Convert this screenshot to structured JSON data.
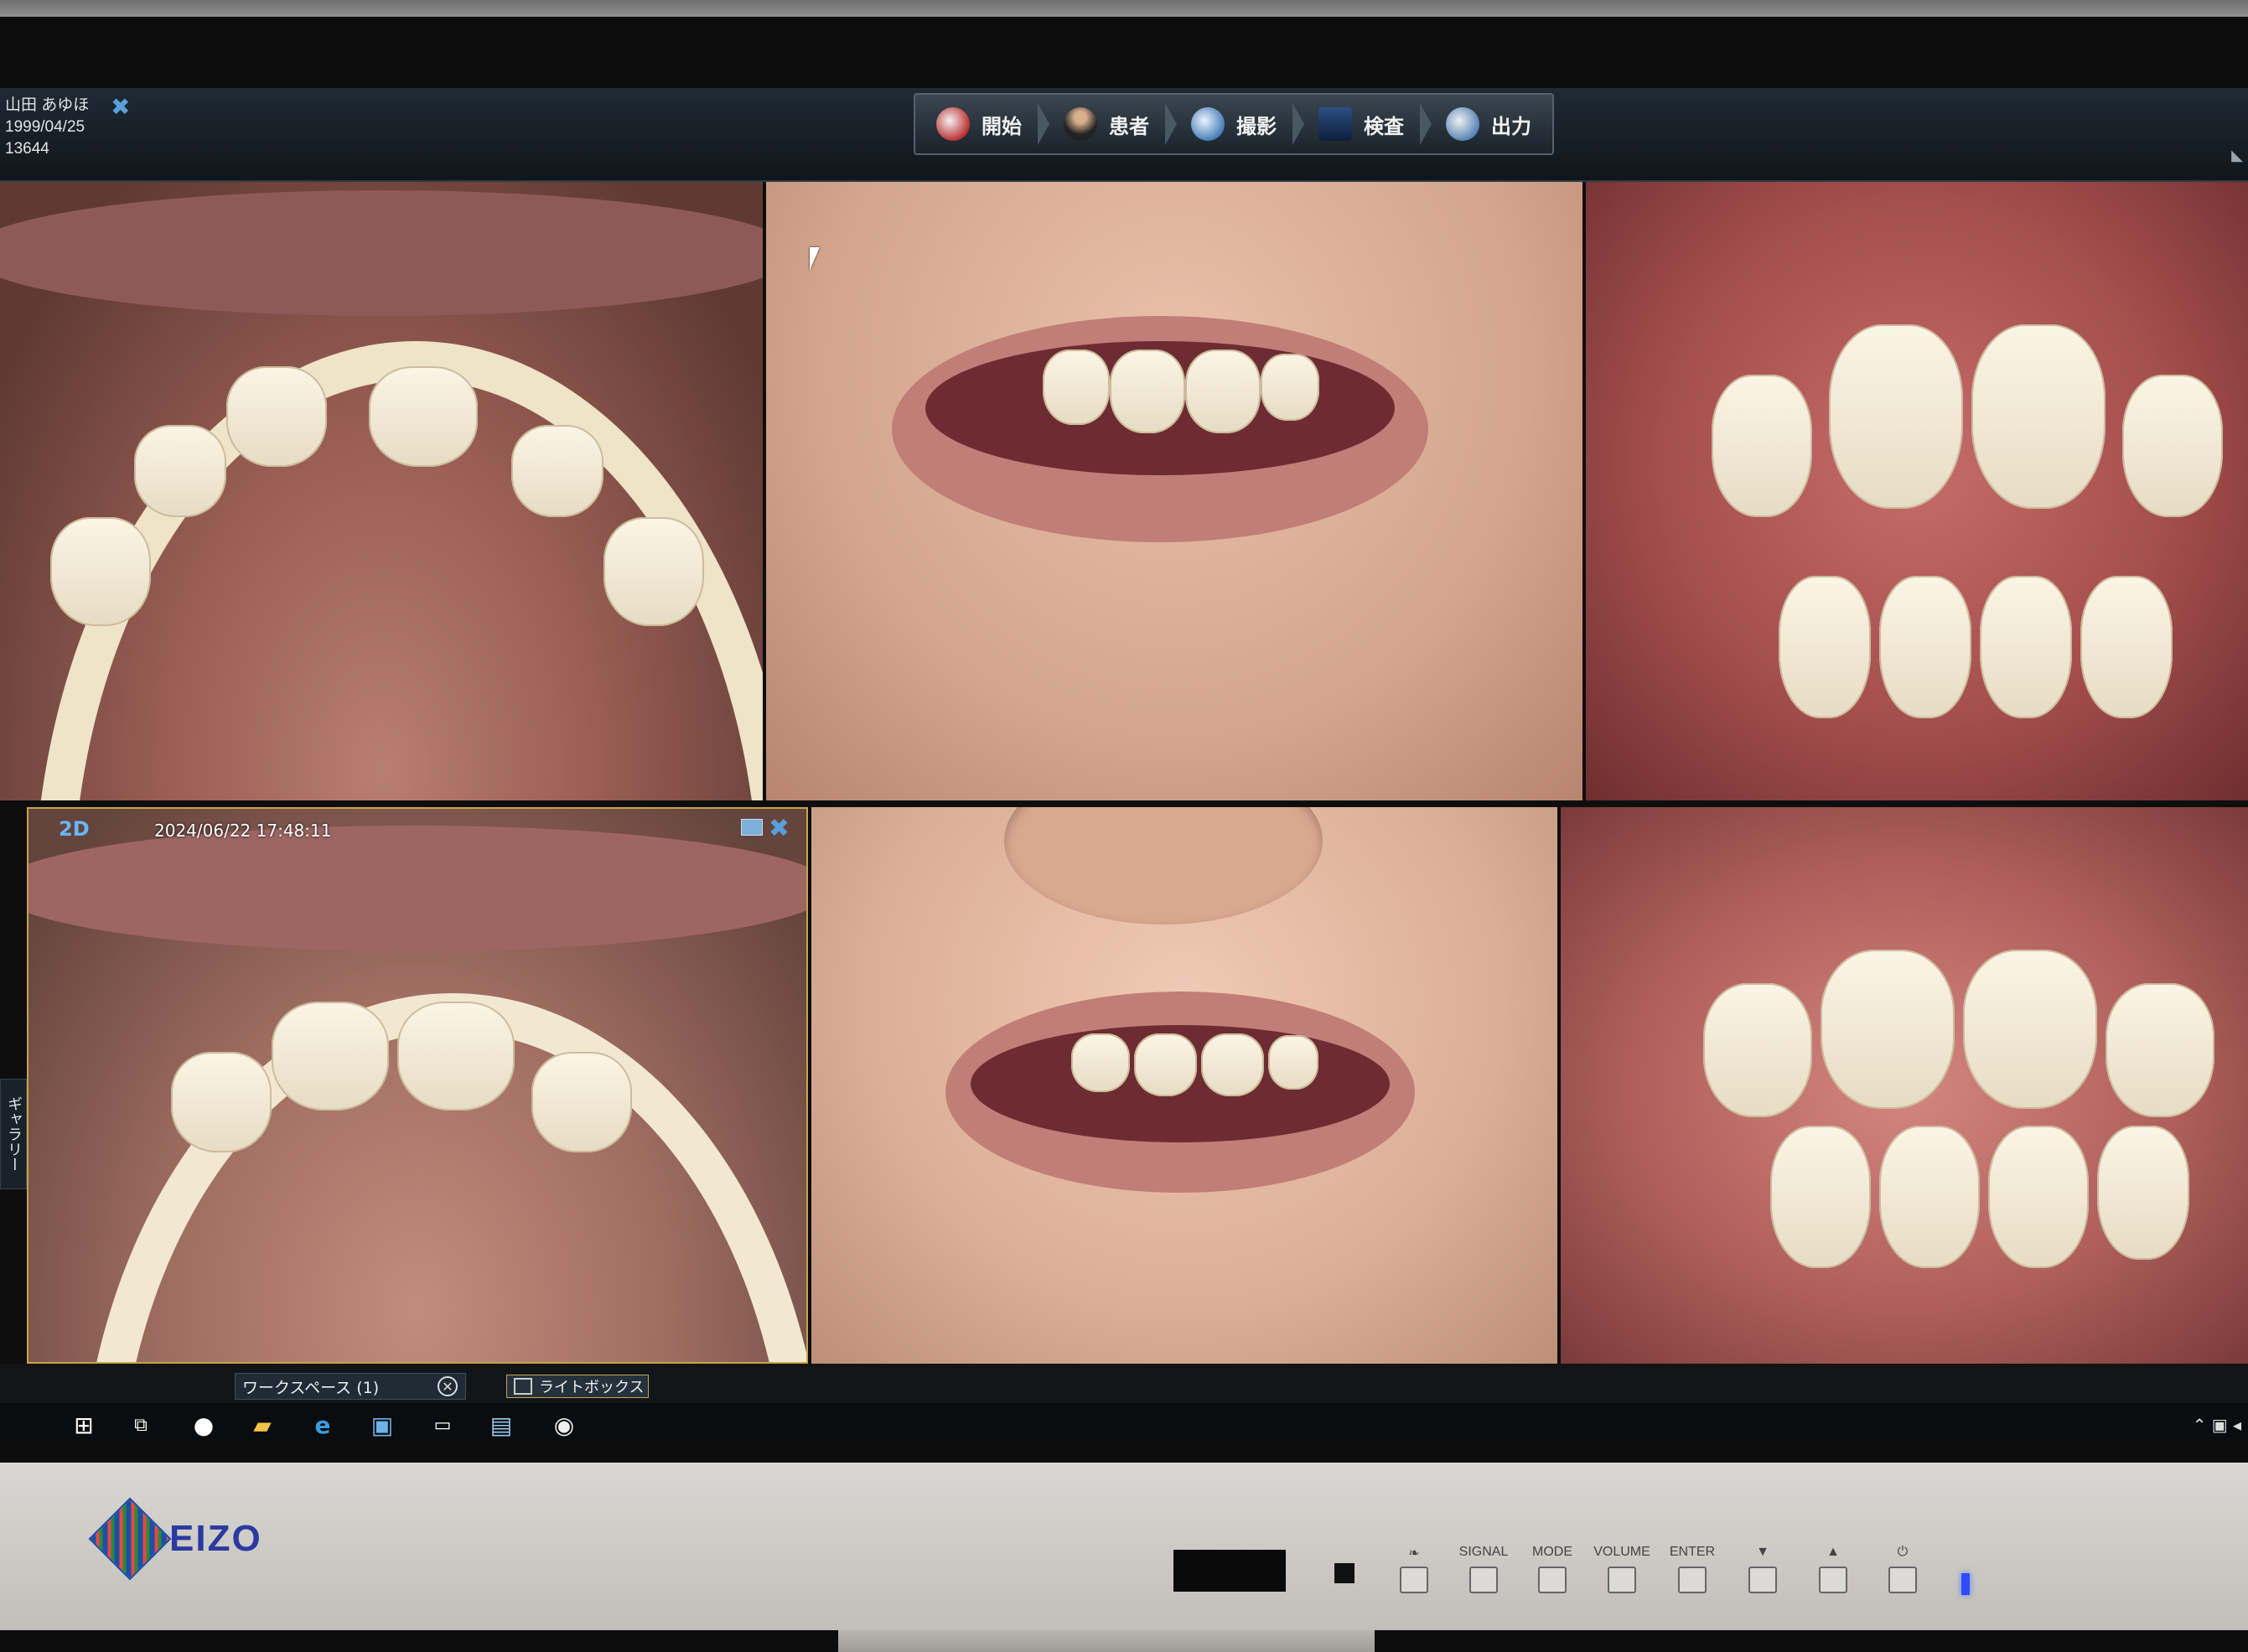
{
  "patient": {
    "name": "山田 あゆほ",
    "birthdate": "1999/04/25",
    "id": "13644"
  },
  "nav": {
    "items": [
      {
        "label": "開始",
        "icon": "home-icon",
        "color": "#b33"
      },
      {
        "label": "患者",
        "icon": "patient-icon",
        "color": "#555"
      },
      {
        "label": "撮影",
        "icon": "capture-icon",
        "color": "#4a7fb8"
      },
      {
        "label": "検査",
        "icon": "exam-icon",
        "color": "#1f3d6b"
      },
      {
        "label": "出力",
        "icon": "output-icon",
        "color": "#5b86b5"
      }
    ]
  },
  "viewer": {
    "mode_badge": "2D",
    "timestamp": "2024/06/22 17:48:11"
  },
  "gallery_tab": "ギャラリー",
  "workspace_tabs": {
    "workspace": "ワークスペース (1)",
    "lightbox": "ライトボックス"
  },
  "monitor": {
    "brand": "EIZO",
    "buttons": [
      {
        "label": "",
        "icon": "eco-icon"
      },
      {
        "label": "SIGNAL"
      },
      {
        "label": "MODE"
      },
      {
        "label": "VOLUME"
      },
      {
        "label": "ENTER"
      },
      {
        "label": "▼"
      },
      {
        "label": "▲"
      },
      {
        "label": "⏻"
      }
    ]
  },
  "colors": {
    "accent_blue": "#67b6ff",
    "frame_gold": "#c9a34c",
    "power_led": "#2f4bff"
  }
}
